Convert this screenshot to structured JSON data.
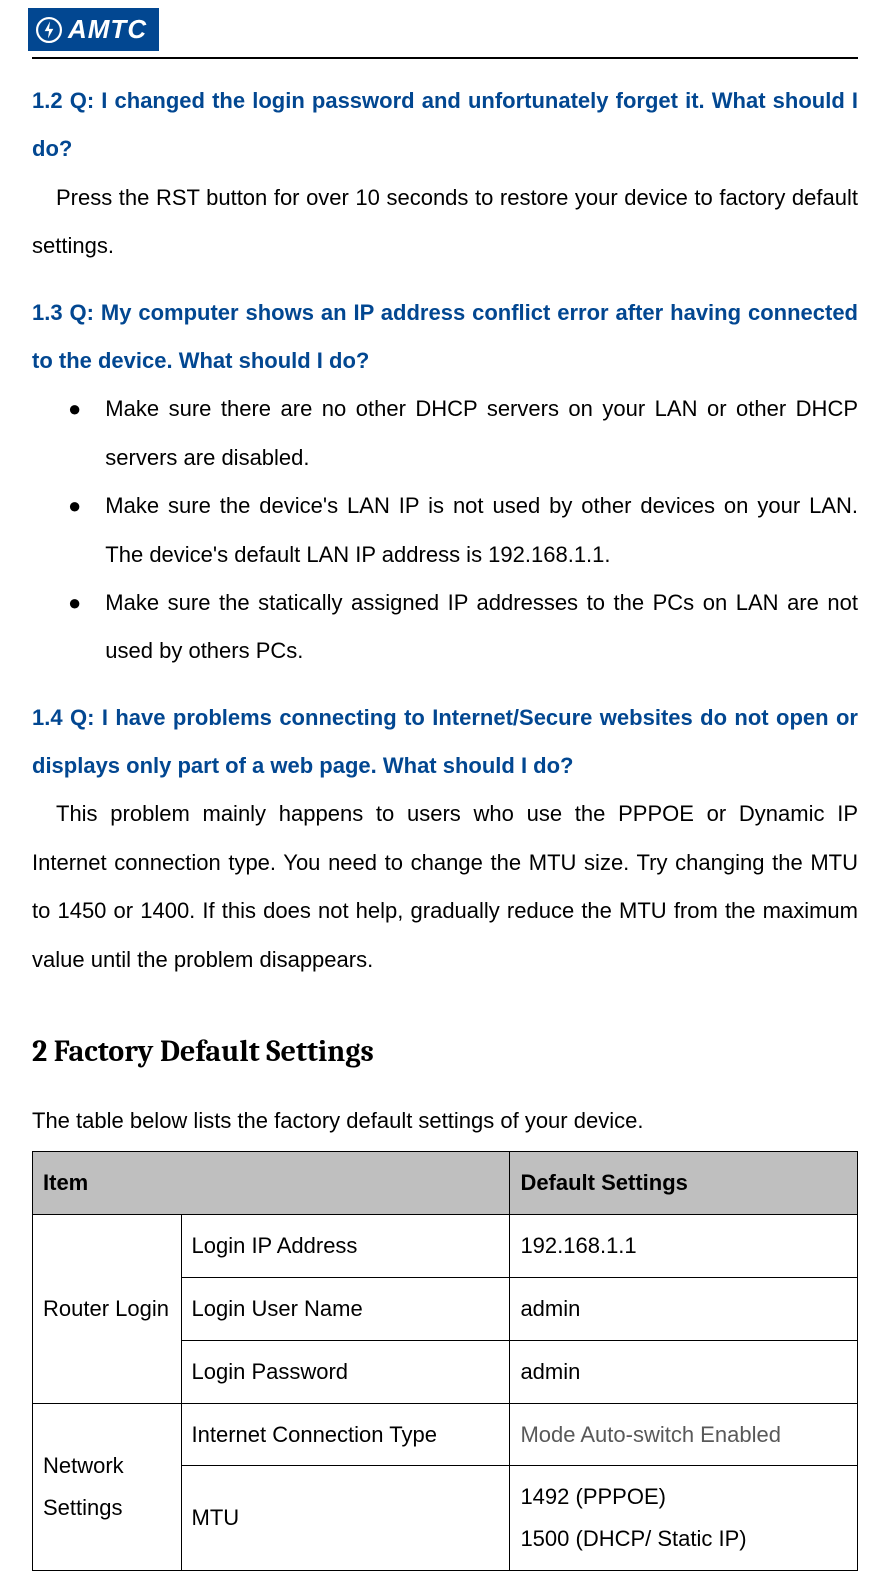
{
  "logo": {
    "text": "AMTC"
  },
  "faq": {
    "q12": {
      "q": "1.2 Q: I changed the login password and unfortunately forget it. What should I do?",
      "a": "Press the RST button for over 10 seconds to restore your device to factory default settings."
    },
    "q13": {
      "q": "1.3 Q: My computer shows an IP address conflict error after having connected to the device. What should I do?",
      "b1": "Make sure there are no other DHCP servers on your LAN or other DHCP servers are disabled.",
      "b2": "Make sure the device's LAN IP is not used by other devices on your LAN. The device's default LAN IP address is 192.168.1.1.",
      "b3": "Make sure the statically assigned IP addresses to the PCs on LAN are not used by others PCs."
    },
    "q14": {
      "q": "1.4 Q: I have problems connecting to Internet/Secure websites do not open or displays only part of a web page. What should I do?",
      "a": "This problem mainly happens to users who use the PPPOE or Dynamic IP Internet connection type. You need to change the MTU size. Try changing the MTU to 1450 or 1400. If this does not help, gradually reduce the MTU from the maximum value until the problem disappears."
    }
  },
  "section2": {
    "title": "2 Factory Default Settings",
    "intro": "The table below lists the factory default settings of your device.",
    "table": {
      "h1": "Item",
      "h2": "Default Settings",
      "group1": "Router Login",
      "r1k": "Login IP Address",
      "r1v": "192.168.1.1",
      "r2k": "Login User Name",
      "r2v": "admin",
      "r3k": "Login Password",
      "r3v": "admin",
      "group2": "Network Settings",
      "r4k": "Internet Connection Type",
      "r4v": "Mode Auto-switch Enabled",
      "r5k": "MTU",
      "r5v1": "1492 (PPPOE)",
      "r5v2": "1500 (DHCP/ Static IP)"
    }
  }
}
